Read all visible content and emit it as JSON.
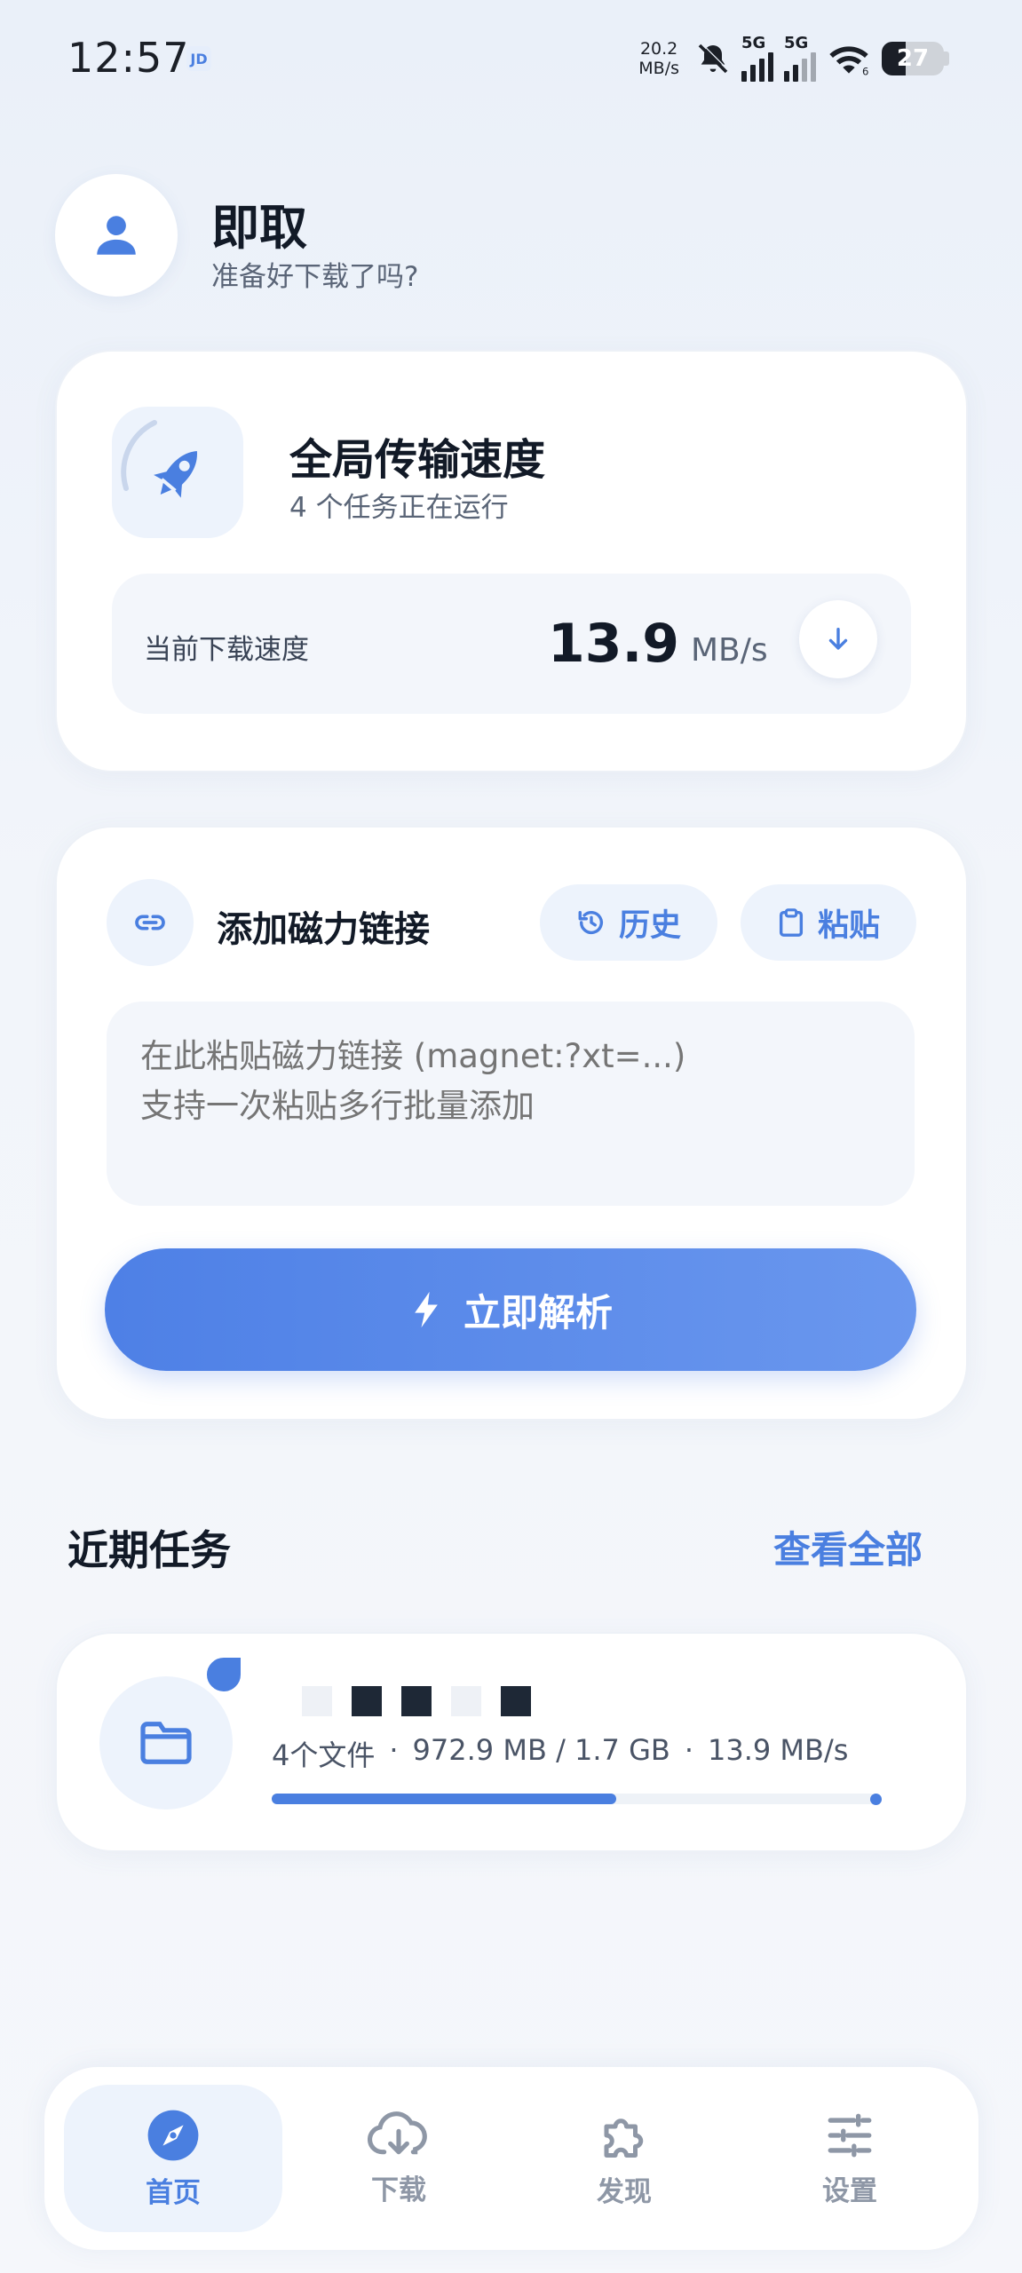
{
  "status_bar": {
    "time": "12:57",
    "app_icon_label": "JD",
    "net_speed_value": "20.2",
    "net_speed_unit": "MB/s",
    "sim1_label": "5G",
    "sim2_label": "5G",
    "wifi_label": "6",
    "battery_level": "27"
  },
  "header": {
    "title": "即取",
    "subtitle": "准备好下载了吗?"
  },
  "speed_card": {
    "title": "全局传输速度",
    "subtitle": "4 个任务正在运行",
    "current_label": "当前下载速度",
    "speed_value": "13.9",
    "speed_unit": "MB/s"
  },
  "add_card": {
    "title": "添加磁力链接",
    "history_label": "历史",
    "paste_label": "粘贴",
    "placeholder": "在此粘贴磁力链接 (magnet:?xt=...)\n支持一次粘贴多行批量添加",
    "parse_label": "立即解析"
  },
  "recent": {
    "title": "近期任务",
    "view_all": "查看全部",
    "task": {
      "file_count": "4个文件",
      "separator": "·",
      "size": "972.9 MB / 1.7 GB",
      "speed": "13.9 MB/s",
      "progress": 0.57
    }
  },
  "nav": {
    "items": [
      {
        "label": "首页",
        "icon": "compass-icon",
        "active": true
      },
      {
        "label": "下载",
        "icon": "cloud-download-icon",
        "active": false
      },
      {
        "label": "发现",
        "icon": "puzzle-icon",
        "active": false
      },
      {
        "label": "设置",
        "icon": "sliders-icon",
        "active": false
      }
    ]
  },
  "colors": {
    "accent": "#4a7fe0",
    "text_primary": "#121a27",
    "text_secondary": "#5a6577",
    "panel": "#f3f6fb"
  }
}
